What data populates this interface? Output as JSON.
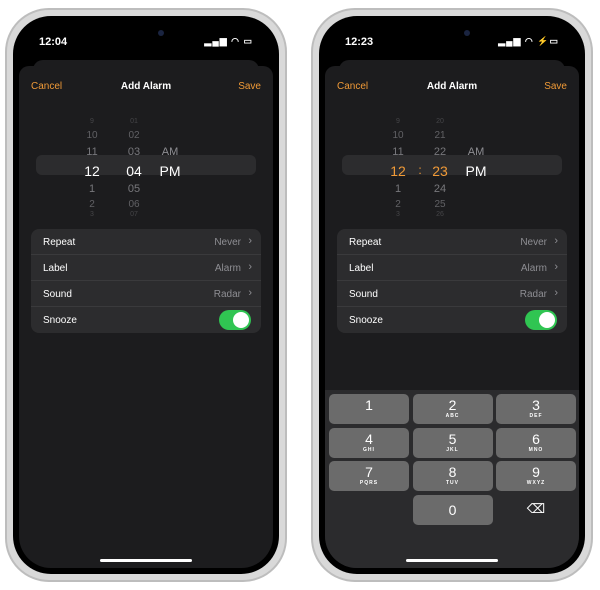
{
  "phones": [
    {
      "status_time": "12:04",
      "battery": "normal",
      "header": {
        "cancel": "Cancel",
        "title": "Add Alarm",
        "save": "Save"
      },
      "picker": {
        "hours": [
          "9",
          "10",
          "11",
          "12",
          "1",
          "2",
          "3"
        ],
        "minutes": [
          "01",
          "02",
          "03",
          "04",
          "05",
          "06",
          "07"
        ],
        "ampm": [
          "AM",
          "PM"
        ],
        "separator": "",
        "selected_color": "#ffffff"
      },
      "settings": [
        {
          "label": "Repeat",
          "value": "Never"
        },
        {
          "label": "Label",
          "value": "Alarm"
        },
        {
          "label": "Sound",
          "value": "Radar"
        },
        {
          "label": "Snooze",
          "toggle": true
        }
      ],
      "keyboard": false
    },
    {
      "status_time": "12:23",
      "battery": "charging",
      "header": {
        "cancel": "Cancel",
        "title": "Add Alarm",
        "save": "Save"
      },
      "picker": {
        "hours": [
          "9",
          "10",
          "11",
          "12",
          "1",
          "2",
          "3"
        ],
        "minutes": [
          "20",
          "21",
          "22",
          "23",
          "24",
          "25",
          "26"
        ],
        "ampm": [
          "AM",
          "PM"
        ],
        "separator": ":",
        "selected_color": "#f09a37"
      },
      "settings": [
        {
          "label": "Repeat",
          "value": "Never"
        },
        {
          "label": "Label",
          "value": "Alarm"
        },
        {
          "label": "Sound",
          "value": "Radar"
        },
        {
          "label": "Snooze",
          "toggle": true
        }
      ],
      "keyboard": true
    }
  ],
  "keypad": [
    {
      "d": "1",
      "l": ""
    },
    {
      "d": "2",
      "l": "ABC"
    },
    {
      "d": "3",
      "l": "DEF"
    },
    {
      "d": "4",
      "l": "GHI"
    },
    {
      "d": "5",
      "l": "JKL"
    },
    {
      "d": "6",
      "l": "MNO"
    },
    {
      "d": "7",
      "l": "PQRS"
    },
    {
      "d": "8",
      "l": "TUV"
    },
    {
      "d": "9",
      "l": "WXYZ"
    },
    {
      "d": "0",
      "l": ""
    }
  ],
  "delete_icon": "⌫",
  "accent": "#f09a37"
}
